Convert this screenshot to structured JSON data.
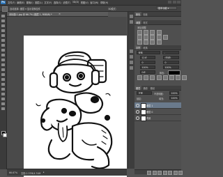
{
  "app": {
    "logo": "Ps"
  },
  "menu": [
    "文件(F)",
    "编辑(E)",
    "图像(I)",
    "图层(L)",
    "文字(Y)",
    "选择(S)",
    "滤镜(T)",
    "3D(D)",
    "视图(V)",
    "窗口(W)",
    "帮助(H)"
  ],
  "options_bar": {
    "text": "自动选择: 图层 ▾  显示变换控件",
    "mode_3d": "3D模式:",
    "workspace": "基本功能 ▾"
  },
  "document": {
    "tab_label": "未标题-1.jpg @ 66.7% (图层 1, RGB/8) *",
    "close": "×"
  },
  "status": {
    "zoom": "66.67%",
    "doc": "文档:2.37M/4.74M",
    "arrow": "▸"
  },
  "panels": {
    "top_tabs": [
      "颜色",
      "色板"
    ],
    "adjust_tabs": [
      "调整",
      "样式"
    ],
    "adjust_title": "添加调整",
    "char_tabs": [
      "字符",
      "段落"
    ],
    "font_family": "宋体",
    "font_style": "-",
    "font_size": "12点",
    "leading": "(自动)",
    "kerning": "0",
    "tracking": "0",
    "scale_v": "100%",
    "scale_h": "100%",
    "baseline": "0点",
    "color_label": "颜色:",
    "layer_tabs": [
      "图层",
      "通道",
      "路径"
    ],
    "blend_mode": "正常",
    "opacity_label": "不透明度:",
    "opacity": "100%",
    "lock_label": "锁定:",
    "fill_label": "填充:",
    "fill": "100%",
    "layers": [
      {
        "name": "图层 1",
        "selected": true
      },
      {
        "name": "图层 0",
        "selected": false
      },
      {
        "name": "背景",
        "selected": false
      }
    ]
  },
  "colors": {
    "accent": "#2b74b8",
    "selection": "#6a7a8c",
    "ui_dark": "#3c3c3c"
  }
}
